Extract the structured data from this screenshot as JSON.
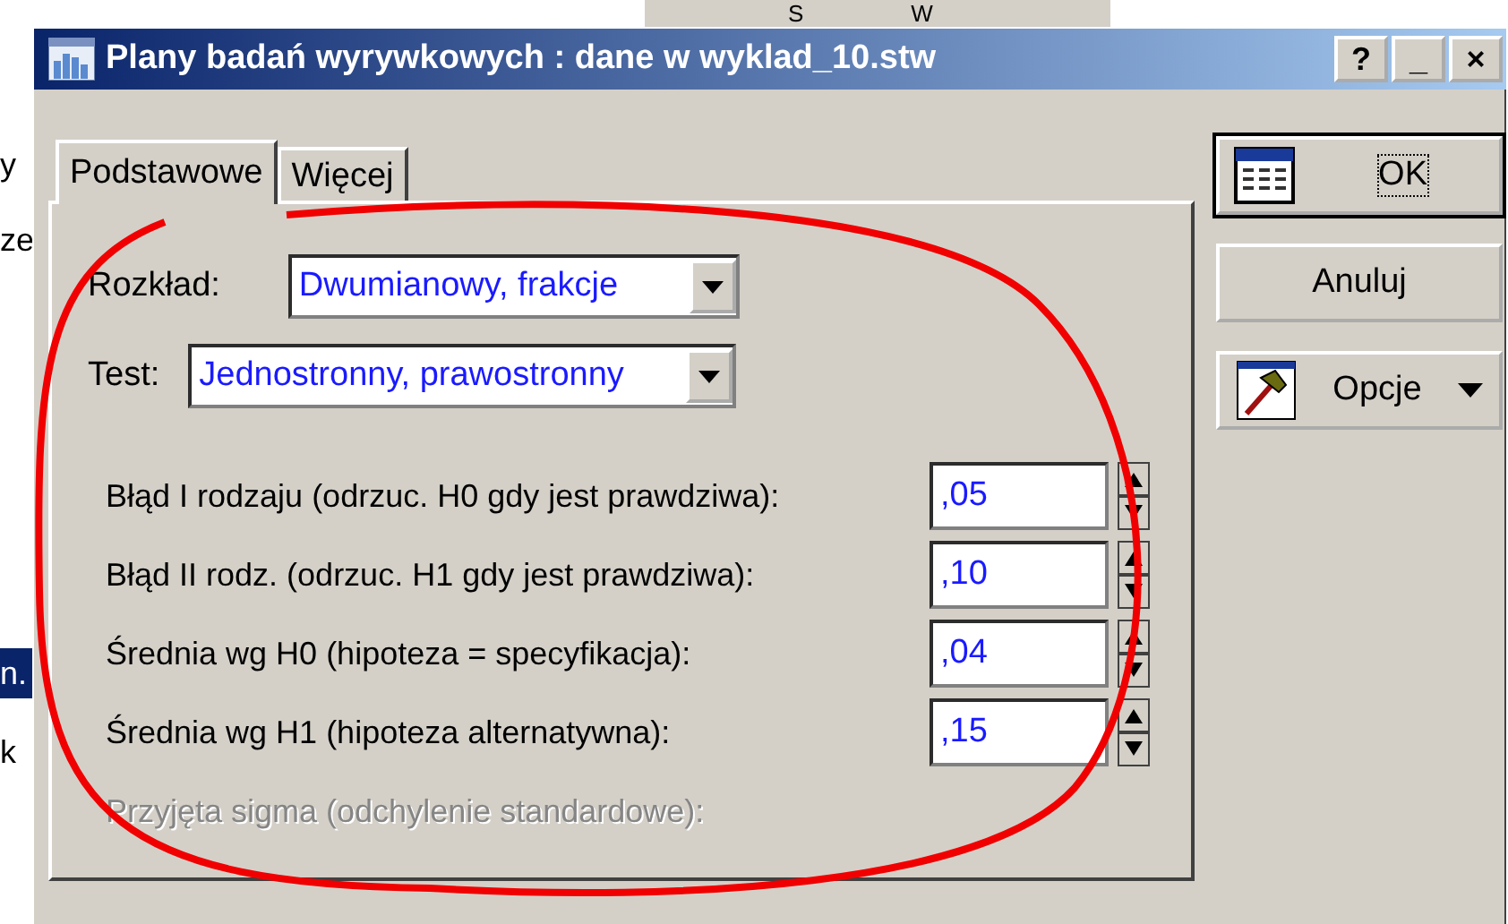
{
  "background": {
    "toolbar": [
      "S",
      "W"
    ],
    "side_items": [
      {
        "text": "y",
        "selected": false
      },
      {
        "text": "ze",
        "selected": false
      },
      {
        "text": "n.",
        "selected": true
      },
      {
        "text": "k",
        "selected": false
      }
    ]
  },
  "window": {
    "title": "Plany badań wyrywkowych : dane w wyklad_10.stw",
    "controls": [
      "?",
      "_",
      "×"
    ]
  },
  "tabs": [
    {
      "label": "Podstawowe",
      "selected": true
    },
    {
      "label": "Więcej",
      "selected": false
    }
  ],
  "combos": [
    {
      "label": "Rozkład:",
      "value": "Dwumianowy, frakcje"
    },
    {
      "label": "Test:",
      "value": "Jednostronny, prawostronny"
    }
  ],
  "parameters": [
    {
      "label": "Błąd I rodzaju (odrzuc. H0 gdy jest prawdziwa):",
      "value": ",05",
      "disabled": false
    },
    {
      "label": "Błąd II rodz. (odrzuc. H1 gdy jest prawdziwa):",
      "value": ",10",
      "disabled": false
    },
    {
      "label": "Średnia wg H0 (hipoteza = specyfikacja):",
      "value": ",04",
      "disabled": false
    },
    {
      "label": "Średnia wg H1 (hipoteza alternatywna):",
      "value": ",15",
      "disabled": false
    },
    {
      "label": "Przyjęta sigma (odchylenie standardowe):",
      "disabled": true
    }
  ],
  "buttons": [
    {
      "label": "OK",
      "kind": "default"
    },
    {
      "label": "Anuluj",
      "kind": "plain"
    },
    {
      "label": "Opcje",
      "kind": "menu"
    }
  ],
  "annotation": {
    "kind": "ellipse"
  }
}
